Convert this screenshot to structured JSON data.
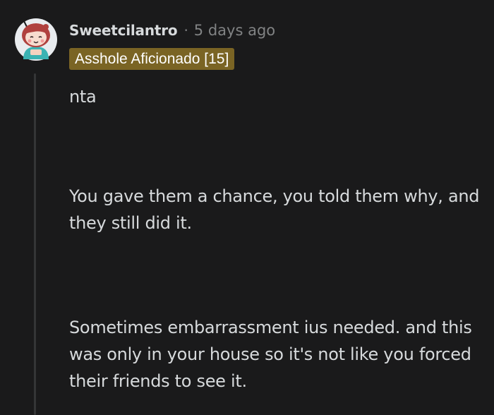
{
  "comment": {
    "author": "Sweetcilantro",
    "separator": "·",
    "timestamp": "5 days ago",
    "flair": "Asshole Aficionado [15]",
    "paragraphs": [
      "nta",
      "You gave them a chance, you told them why, and they still did it.",
      "Sometimes embarrassment ius needed. and this was only in your house so it's not like you forced their friends to see it."
    ]
  },
  "colors": {
    "background": "#1a1a1b",
    "text": "#d7dadc",
    "muted": "#818384",
    "flair_background": "#7a6424",
    "thread_line": "#343536"
  },
  "icons": {
    "avatar": "snoo-avatar-icon"
  }
}
